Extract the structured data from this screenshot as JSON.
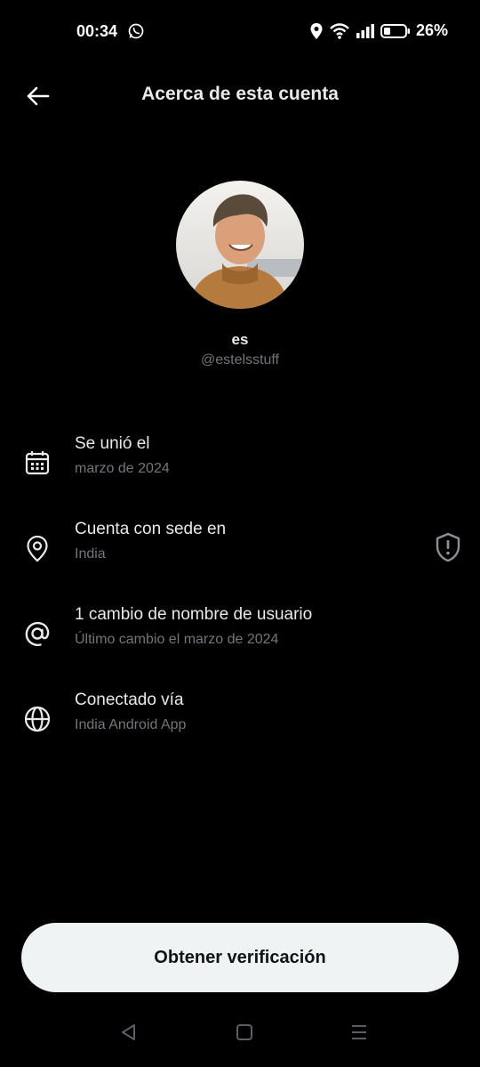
{
  "status_bar": {
    "time": "00:34",
    "battery": "26%"
  },
  "header": {
    "title": "Acerca de esta cuenta"
  },
  "profile": {
    "display_name": "es",
    "handle": "@estelsstuff"
  },
  "info": [
    {
      "icon": "calendar-icon",
      "title": "Se unió el",
      "subtitle": "marzo de 2024"
    },
    {
      "icon": "location-pin-icon",
      "title": "Cuenta con sede en",
      "subtitle": "India"
    },
    {
      "icon": "at-sign-icon",
      "title": "1 cambio de nombre de usuario",
      "subtitle": "Último cambio el marzo de 2024"
    },
    {
      "icon": "globe-icon",
      "title": "Conectado vía",
      "subtitle": "India Android App"
    }
  ],
  "verify_button": {
    "label": "Obtener verificación"
  },
  "colors": {
    "background": "#000000",
    "text": "#e7e9ea",
    "secondary_text": "#71767b",
    "button_bg": "#eff3f4"
  }
}
